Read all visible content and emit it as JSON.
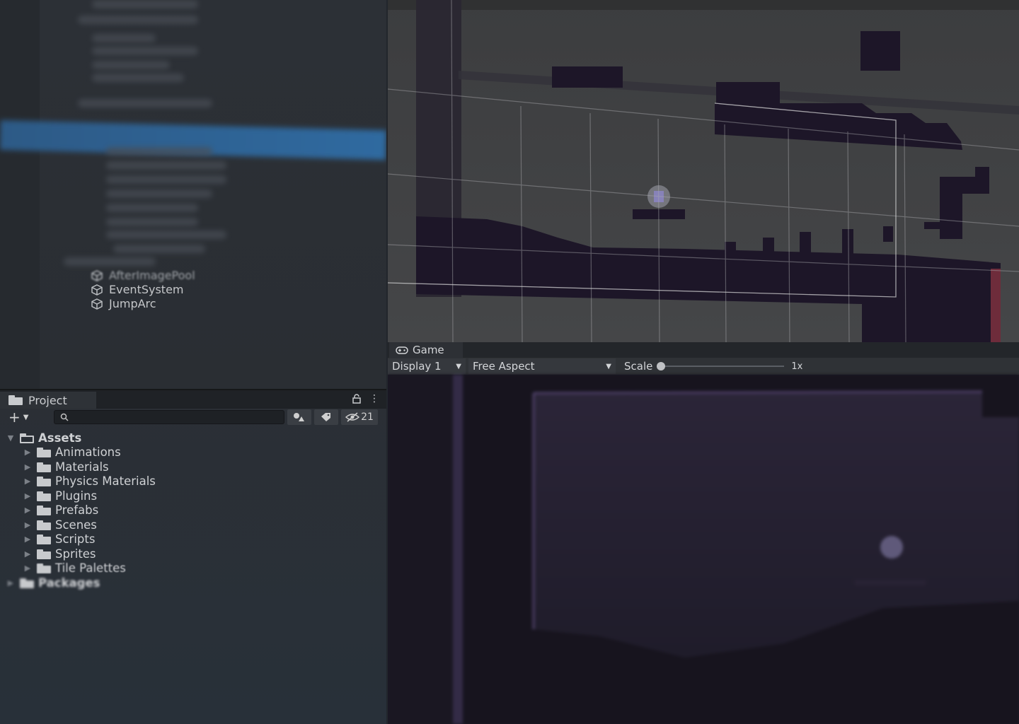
{
  "hierarchy": {
    "items": [
      {
        "label": "AfterImagePool"
      },
      {
        "label": "EventSystem"
      },
      {
        "label": "JumpArc"
      }
    ]
  },
  "project": {
    "tab_label": "Project",
    "hidden_count": "21",
    "search_placeholder": "",
    "tree": {
      "root": "Assets",
      "folders": [
        {
          "label": "Animations"
        },
        {
          "label": "Materials"
        },
        {
          "label": "Physics Materials"
        },
        {
          "label": "Plugins"
        },
        {
          "label": "Prefabs"
        },
        {
          "label": "Scenes"
        },
        {
          "label": "Scripts"
        },
        {
          "label": "Sprites"
        },
        {
          "label": "Tile Palettes"
        }
      ],
      "packages": "Packages"
    }
  },
  "game": {
    "tab_label": "Game",
    "display": "Display 1",
    "aspect": "Free Aspect",
    "scale_label": "Scale",
    "scale_value": "1x"
  },
  "colors": {
    "selection": "#2f6aa0",
    "level_tiles": "#1d1628",
    "game_bg": "#2a2437"
  }
}
